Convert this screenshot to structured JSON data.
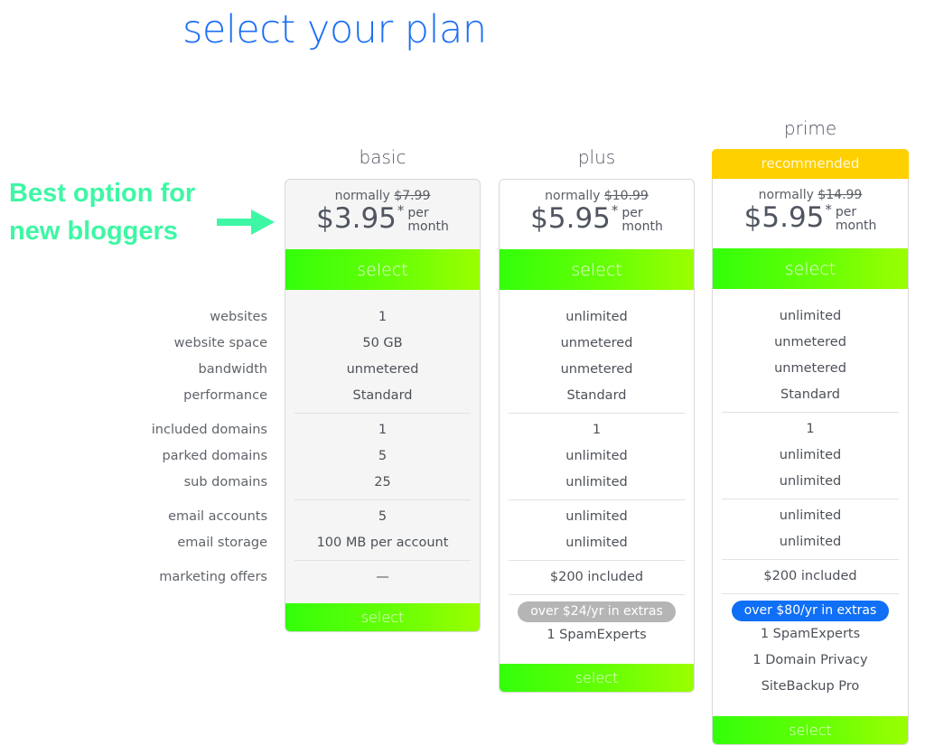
{
  "page": {
    "title": "select your plan",
    "colors": {
      "title_blue": "#1b6ef5",
      "promo_green": "#3ef7a4",
      "select_gradient_start": "#33ff0a",
      "select_gradient_end": "#9bff00",
      "recommended_yellow": "#ffd000",
      "pill_gray": "#b5b5b5",
      "pill_blue": "#0f6ff5"
    }
  },
  "promo": {
    "line1": "Best option for",
    "line2": "new bloggers",
    "icon": "arrow-right-icon"
  },
  "feature_labels": {
    "group1": [
      "websites",
      "website space",
      "bandwidth",
      "performance"
    ],
    "group2": [
      "included domains",
      "parked domains",
      "sub domains"
    ],
    "group3": [
      "email accounts",
      "email storage"
    ],
    "group4": [
      "marketing offers"
    ]
  },
  "plans": [
    {
      "name": "basic",
      "normally_label": "normally",
      "old_price": "$7.99",
      "price": "$3.95",
      "asterisk": "*",
      "per": "per",
      "period": "month",
      "select_label": "select",
      "group1": [
        "1",
        "50 GB",
        "unmetered",
        "Standard"
      ],
      "group2": [
        "1",
        "5",
        "25"
      ],
      "group3": [
        "5",
        "100 MB per account"
      ],
      "group4": [
        "—"
      ]
    },
    {
      "name": "plus",
      "normally_label": "normally",
      "old_price": "$10.99",
      "price": "$5.95",
      "asterisk": "*",
      "per": "per",
      "period": "month",
      "select_label": "select",
      "group1": [
        "unlimited",
        "unmetered",
        "unmetered",
        "Standard"
      ],
      "group2": [
        "1",
        "unlimited",
        "unlimited"
      ],
      "group3": [
        "unlimited",
        "unlimited"
      ],
      "group4": [
        "$200 included"
      ],
      "extras_badge": "over $24/yr in extras",
      "extras": [
        "1 SpamExperts"
      ]
    },
    {
      "name": "prime",
      "badge": "recommended",
      "normally_label": "normally",
      "old_price": "$14.99",
      "price": "$5.95",
      "asterisk": "*",
      "per": "per",
      "period": "month",
      "select_label": "select",
      "group1": [
        "unlimited",
        "unmetered",
        "unmetered",
        "Standard"
      ],
      "group2": [
        "1",
        "unlimited",
        "unlimited"
      ],
      "group3": [
        "unlimited",
        "unlimited"
      ],
      "group4": [
        "$200 included"
      ],
      "extras_badge": "over $80/yr in extras",
      "extras": [
        "1 SpamExperts",
        "1 Domain Privacy",
        "SiteBackup Pro"
      ]
    }
  ]
}
